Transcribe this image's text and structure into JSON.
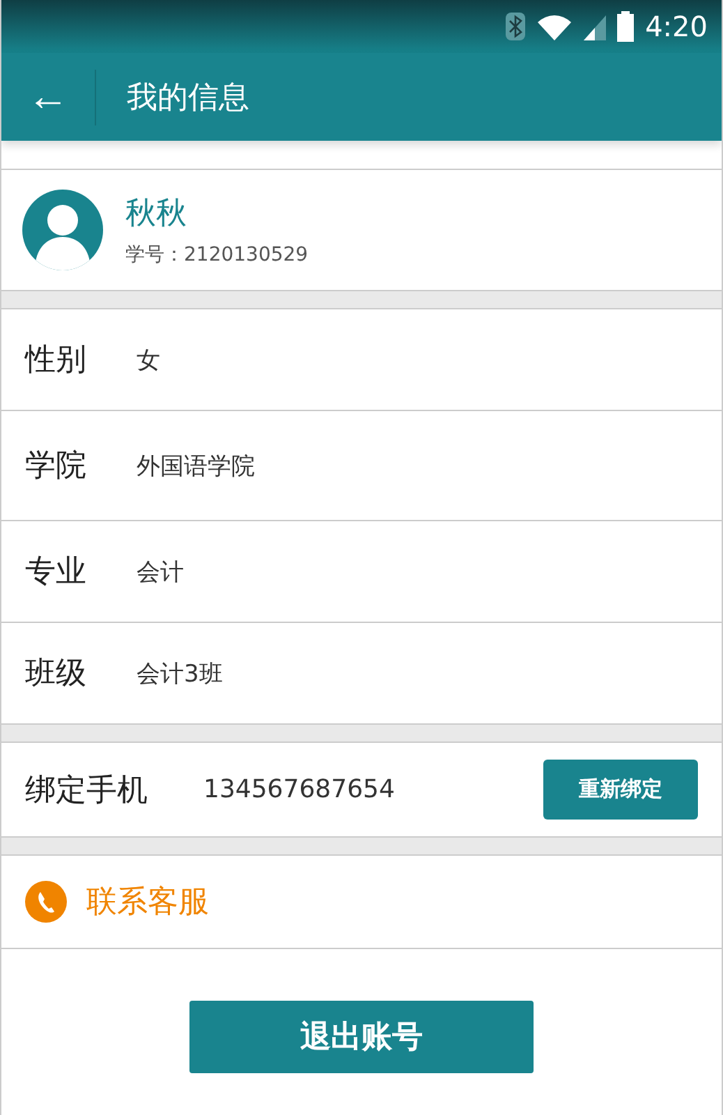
{
  "status_bar": {
    "time": "4:20"
  },
  "app_bar": {
    "back": "←",
    "title": "我的信息"
  },
  "profile": {
    "name": "秋秋",
    "id_label": "学号：",
    "id": "2120130529"
  },
  "fields": [
    {
      "label": "性别",
      "value": "女"
    },
    {
      "label": "学院",
      "value": "外国语学院"
    },
    {
      "label": "专业",
      "value": "会计"
    },
    {
      "label": "班级",
      "value": "会计3班"
    }
  ],
  "phone": {
    "label": "绑定手机",
    "value": "134567687654",
    "button": "重新绑定"
  },
  "contact": {
    "label": "联系客服"
  },
  "logout_button": "退出账号"
}
